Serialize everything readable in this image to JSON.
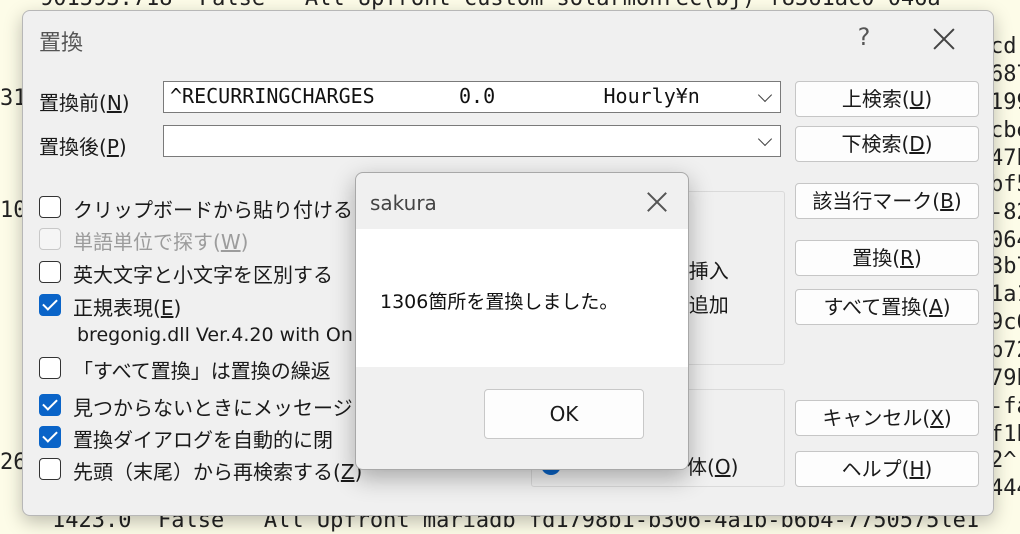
{
  "background": {
    "top_line": "901593.718^ False^  All Upfront^custom-solarmonrec(bj)^f8361ac0-046a-",
    "bottom_line": "1423.0  False   All Upfront mariadb fd1798b1-b306-4a1b-b6b4-7750575le1",
    "right_fragments": [
      "cd-",
      "687",
      "199",
      "cbe",
      "47b",
      "bf5",
      "-82",
      "064",
      "3b7",
      "1a1",
      "9c6",
      "b72",
      "79b",
      "-fa",
      "f1b",
      "2^",
      "444"
    ],
    "left_fragments": [
      "31",
      "10",
      "26"
    ]
  },
  "replace_dialog": {
    "title": "置換",
    "help_label": "?",
    "find_label": "置換前(",
    "find_key": "N",
    "find_value": "^RECURRINGCHARGES\t\t0.0\t\tHourly¥n",
    "replace_label": "置換後(",
    "replace_key": "P",
    "replace_value": "",
    "options": {
      "paste_clipboard": "クリップボードから貼り付ける",
      "word_unit": "単語単位で探す(",
      "word_unit_key": "W",
      "case_sensitive": "英大文字と小文字を区別する",
      "regex": "正規表現(",
      "regex_key": "E",
      "regex_lib": "bregonig.dll Ver.4.20 with On",
      "replace_all_repeat": "「すべて置換」は置換の繰返",
      "show_message": "見つからないときにメッセージ",
      "auto_close": "置換ダイアログを自動的に閉",
      "wrap_search": "先頭（末尾）から再検索する(",
      "wrap_search_key": "Z"
    },
    "insert_fragment": ")挿入",
    "append_fragment": ")追加",
    "paren_fragment": ")",
    "scope_whole": "体(",
    "scope_whole_key": "O",
    "scope_paren_fragment": ")",
    "buttons": {
      "find_up": "上検索(",
      "find_up_key": "U",
      "find_down": "下検索(",
      "find_down_key": "D",
      "mark_lines": "該当行マーク(",
      "mark_lines_key": "B",
      "replace": "置換(",
      "replace_key": "R",
      "replace_all": "すべて置換(",
      "replace_all_key": "A",
      "cancel": "キャンセル(",
      "cancel_key": "X",
      "help": "ヘルプ(",
      "help_key": "H"
    }
  },
  "message_box": {
    "title": "sakura",
    "message": "1306箇所を置換しました。",
    "ok_label": "OK"
  }
}
